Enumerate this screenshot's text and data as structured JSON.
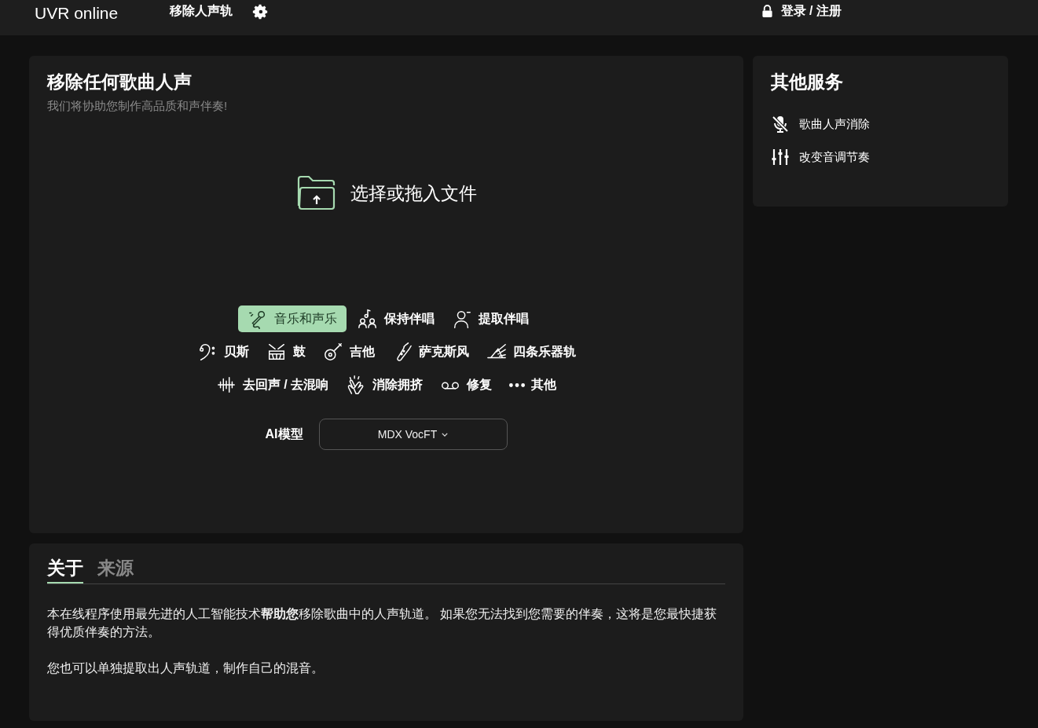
{
  "header": {
    "logo": "UVR online",
    "nav": "移除人声轨",
    "login": "登录 / 注册"
  },
  "main": {
    "title": "移除任何歌曲人声",
    "subtitle": "我们将协助您制作高品质和声伴奏!",
    "upload": "选择或拖入文件",
    "mode_rows": [
      {
        "items": [
          {
            "label": "音乐和声乐",
            "selected": true
          },
          {
            "label": "保持伴唱",
            "selected": false
          },
          {
            "label": "提取伴唱",
            "selected": false
          }
        ]
      },
      {
        "items": [
          {
            "label": "贝斯",
            "selected": false
          },
          {
            "label": "鼓",
            "selected": false
          },
          {
            "label": "吉他",
            "selected": false
          },
          {
            "label": "萨克斯风",
            "selected": false
          },
          {
            "label": "四条乐器轨",
            "selected": false
          }
        ]
      },
      {
        "items": [
          {
            "label": "去回声 / 去混响",
            "selected": false
          },
          {
            "label": "消除拥挤",
            "selected": false
          },
          {
            "label": "修复",
            "selected": false
          },
          {
            "label": "其他",
            "selected": false
          }
        ]
      }
    ],
    "model_label": "AI模型",
    "model_value": "MDX VocFT"
  },
  "other_services": {
    "title": "其他服务",
    "items": [
      "歌曲人声消除",
      "改变音调节奏"
    ]
  },
  "about": {
    "tabs": [
      {
        "label": "关于",
        "selected": true
      },
      {
        "label": "来源",
        "selected": false
      }
    ],
    "paragraphs": [
      "本在线程序使用最先进的人工智能技术**帮助您**移除歌曲中的人声轨道。 如果您无法找到您需要的伴奏，这将是您最快捷获得优质伴奏的方法。",
      "您也可以单独提取出人声轨道，制作自己的混音。"
    ]
  }
}
